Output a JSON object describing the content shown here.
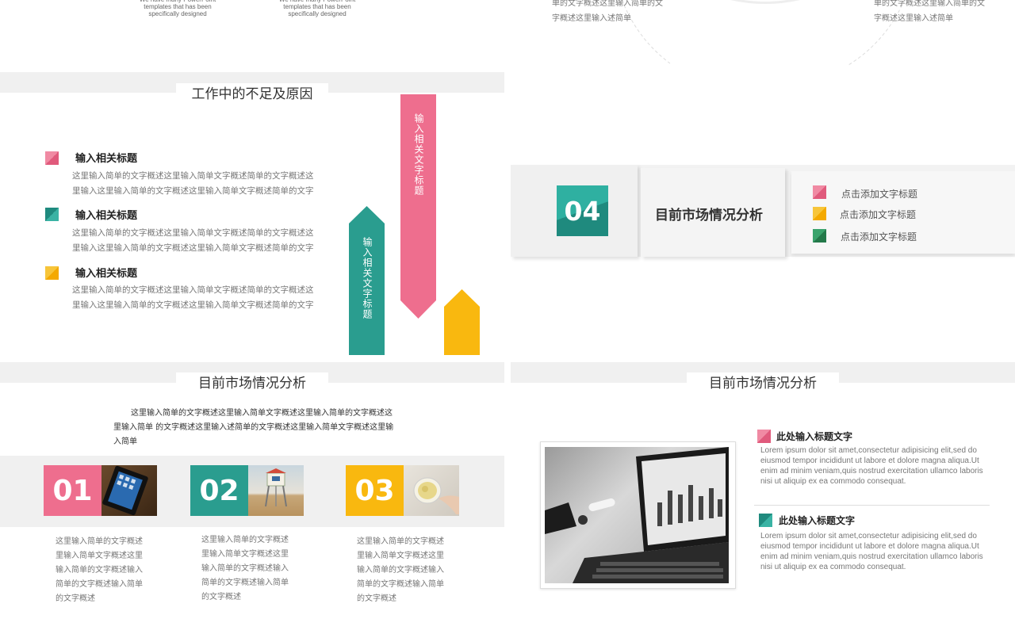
{
  "colors": {
    "pink": "#ee6e8e",
    "teal": "#2a9d8f",
    "yellow": "#f9b80f",
    "green": "#2e8b57",
    "gray_bar": "#f0f0f0"
  },
  "top_left": {
    "blurb1": "We have many PowerPoint templates that has been specifically designed",
    "blurb2": "We have many PowerPoint templates that has been specifically designed"
  },
  "top_right": {
    "text1": "单的文字概述这里输入简单的文字概述这里输入述简单",
    "text2": "单的文字概述这里输入简单的文字概述这里输入述简单"
  },
  "slide_shortcomings": {
    "title": "工作中的不足及原因",
    "items": [
      {
        "heading": "输入相关标题",
        "body": "这里输入简单的文字概述这里输入简单文字概述简单的文字概述这里输入这里输入简单的文字概述这里输入简单文字概述简单的文字"
      },
      {
        "heading": "输入相关标题",
        "body": "这里输入简单的文字概述这里输入简单文字概述简单的文字概述这里输入这里输入简单的文字概述这里输入简单文字概述简单的文字"
      },
      {
        "heading": "输入相关标题",
        "body": "这里输入简单的文字概述这里输入简单文字概述简单的文字概述这里输入这里输入简单的文字概述这里输入简单文字概述简单的文字"
      }
    ],
    "arrow_pink_label": "输入相关文字标题",
    "arrow_teal_label": "输入相关文字标题"
  },
  "slide_section04": {
    "number": "04",
    "title": "目前市场情况分析",
    "legend": [
      "点击添加文字标题",
      "点击添加文字标题",
      "点击添加文字标题"
    ]
  },
  "slide_market_cols": {
    "title": "目前市场情况分析",
    "intro": "这里输入简单的文字概述这里输入简单文字概述这里输入简单的文字概述这里输入简单 的文字概述这里输入述简单的文字概述这里输入简单文字概述这里输入简单",
    "columns": [
      {
        "num": "01",
        "text": "这里输入简单的文字概述里输入简单文字概述这里输入简单的文字概述输入简单的文字概述输入简单的文字概述"
      },
      {
        "num": "02",
        "text": "这里输入简单的文字概述里输入简单文字概述这里输入简单的文字概述输入简单的文字概述输入简单的文字概述"
      },
      {
        "num": "03",
        "text": "这里输入简单的文字概述里输入简单文字概述这里输入简单的文字概述输入简单的文字概述输入简单的文字概述"
      }
    ]
  },
  "slide_market_photo": {
    "title": "目前市场情况分析",
    "entries": [
      {
        "heading": "此处输入标题文字",
        "body": "Lorem ipsum dolor sit amet,consectetur adipisicing elit,sed do eiusmod tempor incididunt ut labore et dolore magna aliqua.Ut enim ad minim veniam,quis nostrud exercitation ullamco laboris nisi ut aliquip ex ea commodo consequat."
      },
      {
        "heading": "此处输入标题文字",
        "body": "Lorem ipsum dolor sit amet,consectetur adipisicing elit,sed do eiusmod tempor incididunt ut labore et dolore magna aliqua.Ut enim ad minim veniam,quis nostrud exercitation ullamco laboris nisi ut aliquip ex ea commodo consequat."
      }
    ]
  }
}
